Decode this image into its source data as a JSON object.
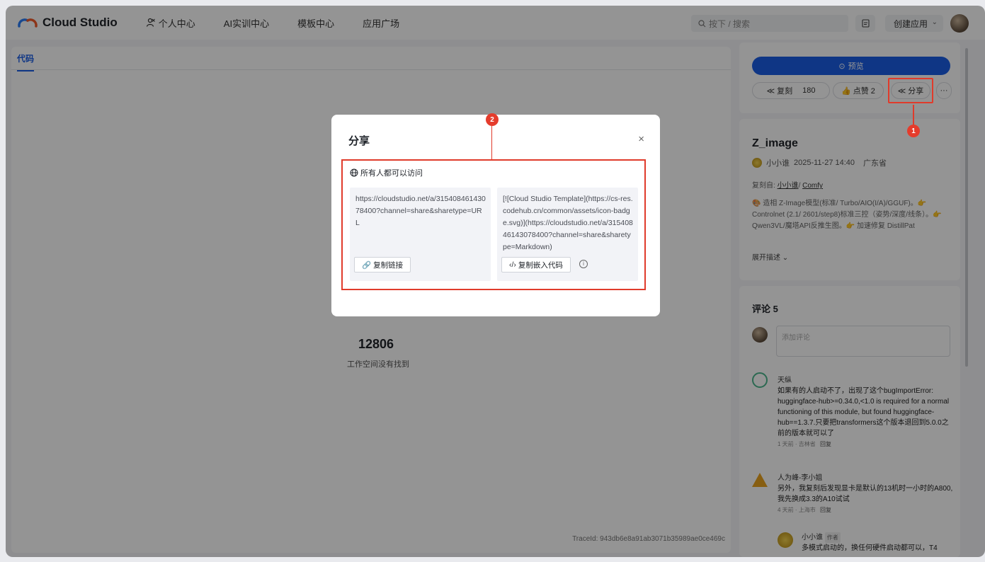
{
  "nav": {
    "logo_text": "Cloud Studio",
    "items": [
      "个人中心",
      "AI实训中心",
      "模板中心",
      "应用广场"
    ],
    "search_placeholder": "按下 / 搜索",
    "create_label": "创建应用"
  },
  "left": {
    "tab_label": "代码",
    "count": "12806",
    "not_found": "工作空间没有找到",
    "trace_id": "TraceId: 943db6e8a91ab3071b35989ae0ce469c"
  },
  "right": {
    "preview_label": "预览",
    "fork_label": "复刻",
    "fork_count": "180",
    "like_label": "点赞 2",
    "share_label": "分享",
    "more_label": "···",
    "project_title": "Z_image",
    "author": "小小谁",
    "datetime": "2025-11-27 14:40",
    "location": "广东省",
    "copied_from_label": "复刻自:",
    "copied_from_user": "小小谁",
    "copied_from_repo": "Comfy",
    "description": "🎨 造相 Z-Image模型(标准/ Turbo/AIO(I/A)/GGUF)。👉 Controlnet (2.1/ 2601/step8)标准三控（姿势/深度/线条）。👉 Qwen3VL/魔塔API反推生图。👉 加速修复 DistillPat",
    "expand_label": "展开描述 ⌄",
    "comments_title": "评论 5",
    "add_comment_placeholder": "添加评论",
    "comments": [
      {
        "name": "天纵",
        "text": "如果有的人启动不了，出现了这个bugImportError: huggingface-hub>=0.34.0,<1.0 is required for a normal functioning of this module, but found huggingface-hub==1.3.7.只要把transformers这个版本退回到5.0.0之前的版本就可以了",
        "meta": "1 天前 · 吉林省",
        "reply": "回复"
      },
      {
        "name": "人为峰-李小姐",
        "text": "另外，我复刻后发现显卡是默认的13机时一小时的A800,我先换成3.3的A10试试",
        "meta": "4 天前 · 上海市",
        "reply": "回复"
      },
      {
        "name": "小小谁",
        "tag": "作者",
        "text": "多模式启动的，换任何硬件启动都可以，T4"
      }
    ]
  },
  "modal": {
    "title": "分享",
    "close": "×",
    "visibility": "所有人都可以访问",
    "url_text": "https://cloudstudio.net/a/31540846143078400?channel=share&sharetype=URL",
    "copy_link_label": "复制链接",
    "markdown_text": "[![Cloud Studio Template](https://cs-res.codehub.cn/common/assets/icon-badge.svg)](https://cloudstudio.net/a/31540846143078400?channel=share&sharetype=Markdown)",
    "copy_embed_label": "复制嵌入代码",
    "info": "i"
  },
  "annotations": {
    "badge1": "1",
    "badge2": "2",
    "color": "#e03b2b"
  }
}
